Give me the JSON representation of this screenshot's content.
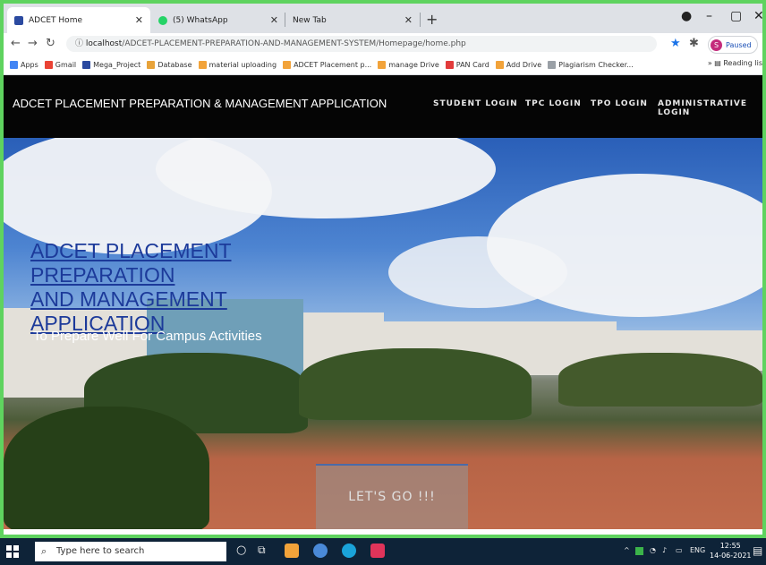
{
  "tabs": [
    {
      "title": "ADCET Home"
    },
    {
      "title": "(5) WhatsApp"
    },
    {
      "title": "New Tab"
    }
  ],
  "address": {
    "host": "localhost",
    "path": "/ADCET-PLACEMENT-PREPARATION-AND-MANAGEMENT-SYSTEM/Homepage/home.php"
  },
  "profile": {
    "initial": "S",
    "status": "Paused"
  },
  "bookmarks": [
    "Apps",
    "Gmail",
    "Mega_Project",
    "Database",
    "material uploading",
    "ADCET Placement p...",
    "manage Drive",
    "PAN Card",
    "Add Drive",
    "Plagiarism Checker..."
  ],
  "reading_list": "Reading lis",
  "site": {
    "brand": "ADCET PLACEMENT PREPARATION & MANAGEMENT APPLICATION",
    "nav": [
      "STUDENT LOGIN",
      "TPC LOGIN",
      "TPO LOGIN",
      "ADMINISTRATIVE LOGIN"
    ]
  },
  "hero": {
    "title_line1": "ADCET PLACEMENT PREPARATION",
    "title_line2": "AND MANAGEMENT APPLICATION",
    "subtitle": "To Prepare Well For Campus Activities",
    "cta": "LET'S GO !!!"
  },
  "taskbar": {
    "search_placeholder": "Type here to search",
    "lang": "ENG",
    "time": "12:55",
    "date": "14-06-2021"
  }
}
